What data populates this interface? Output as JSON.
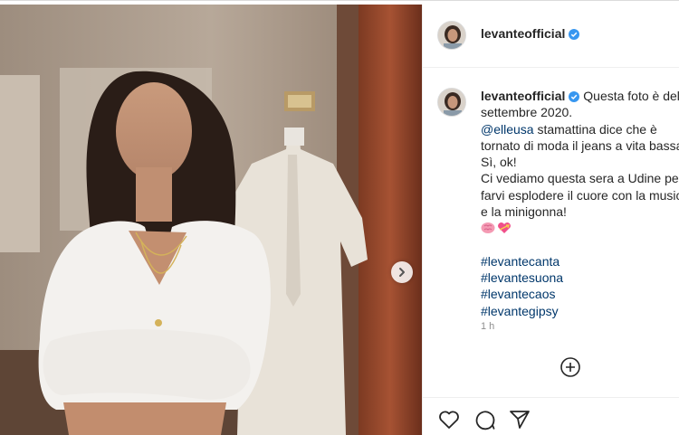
{
  "post": {
    "username": "levanteofficial",
    "verified": true,
    "caption": {
      "first_line_text": "Questa foto è del",
      "line2": "settembre 2020.",
      "mention": "@elleusa",
      "line3_rest": " stamattina dice che è",
      "line4": "tornato di moda il jeans a vita bassa",
      "line5": "Sì, ok!",
      "line6": "Ci vediamo questa sera a Udine per",
      "line7": "farvi esplodere il cuore con la musica",
      "line8": "e la minigonna!",
      "emojis": [
        "brain-emoji",
        "heart-with-ribbon-emoji"
      ],
      "hashtags": [
        "#levantecanta",
        "#levantesuona",
        "#levantecaos",
        "#levantegipsy"
      ]
    },
    "timestamp": "1 h"
  },
  "colors": {
    "link": "#00376b",
    "text": "#262626",
    "muted": "#8e8e8e",
    "verified_badge": "#3897f0"
  },
  "icons": {
    "carousel_next": "chevron-right-icon",
    "load_more": "plus-circle-icon",
    "like": "heart-icon",
    "comment": "comment-icon",
    "share": "paper-plane-icon"
  }
}
